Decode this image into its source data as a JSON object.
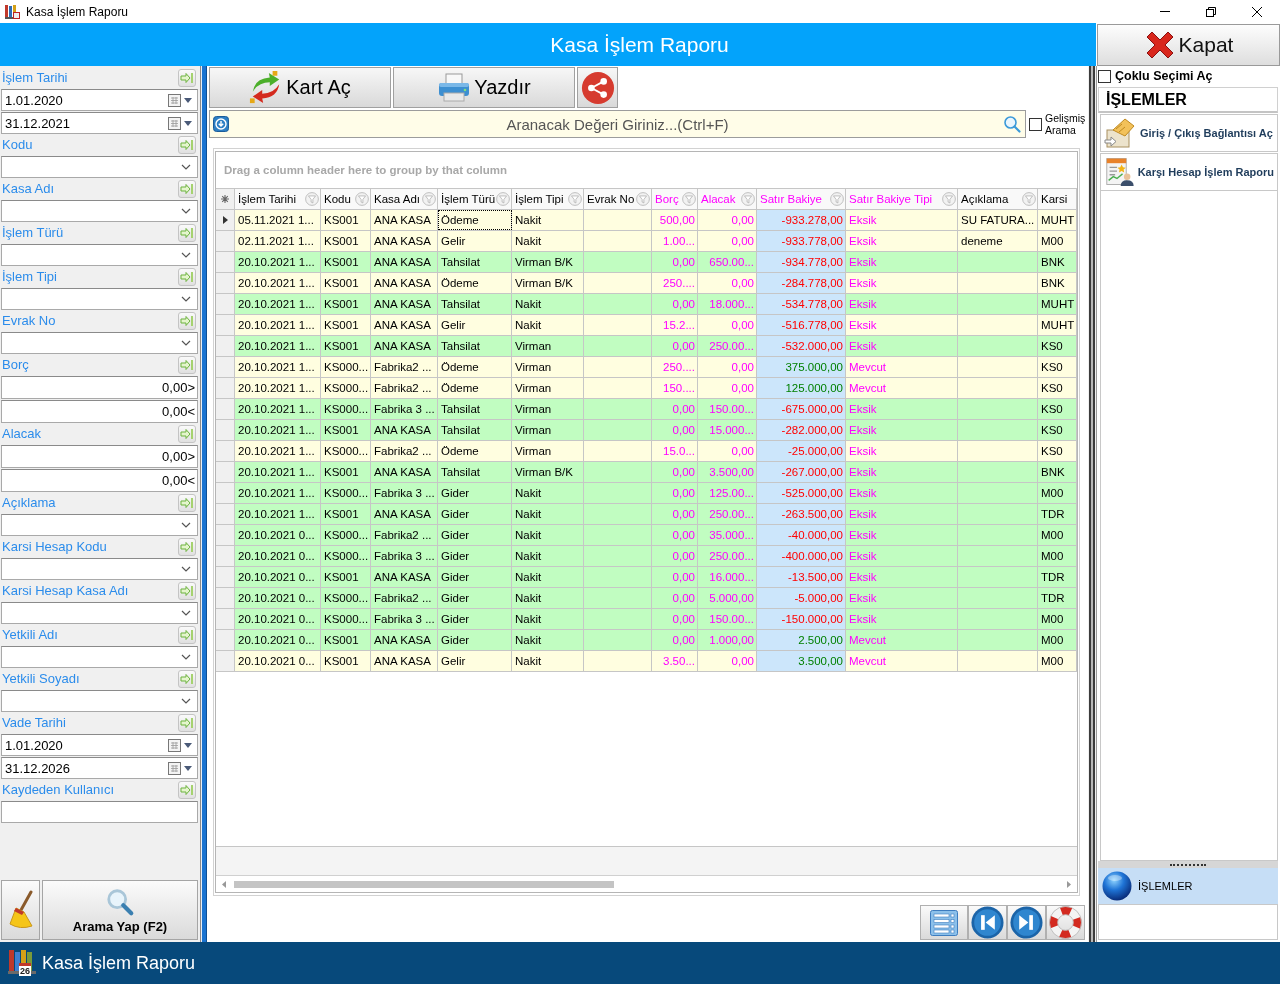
{
  "window": {
    "title": "Kasa İşlem Raporu"
  },
  "header": {
    "title": "Kasa İşlem Raporu",
    "close_button": "Kapat"
  },
  "filters": [
    {
      "kind": "date_range",
      "label": "İşlem Tarihi",
      "values": [
        "1.01.2020",
        "31.12.2021"
      ]
    },
    {
      "kind": "combo",
      "label": "Kodu"
    },
    {
      "kind": "combo",
      "label": "Kasa Adı"
    },
    {
      "kind": "combo",
      "label": "İşlem Türü"
    },
    {
      "kind": "combo",
      "label": "İşlem Tipi"
    },
    {
      "kind": "combo",
      "label": "Evrak No"
    },
    {
      "kind": "number_range",
      "label": "Borç",
      "values": [
        {
          "value": "0,00",
          "operator": ">"
        },
        {
          "value": "0,00",
          "operator": "<"
        }
      ]
    },
    {
      "kind": "number_range",
      "label": "Alacak",
      "values": [
        {
          "value": "0,00",
          "operator": ">"
        },
        {
          "value": "0,00",
          "operator": "<"
        }
      ]
    },
    {
      "kind": "combo",
      "label": "Açıklama"
    },
    {
      "kind": "combo",
      "label": "Karsi Hesap Kodu"
    },
    {
      "kind": "combo",
      "label": "Karsi Hesap Kasa Adı"
    },
    {
      "kind": "combo",
      "label": "Yetkili Adı"
    },
    {
      "kind": "combo",
      "label": "Yetkili Soyadı"
    },
    {
      "kind": "date_range",
      "label": "Vade Tarihi",
      "values": [
        "1.01.2020",
        "31.12.2026"
      ]
    },
    {
      "kind": "text",
      "label": "Kaydeden Kullanıcı"
    }
  ],
  "search_button": "Arama Yap (F2)",
  "toolbar": [
    {
      "kind": "open_card",
      "label": "Kart Aç"
    },
    {
      "kind": "print",
      "label": "Yazdır"
    },
    {
      "kind": "share"
    }
  ],
  "search": {
    "placeholder": "Aranacak Değeri Giriniz...(Ctrl+F)",
    "advanced_label": "Gelişmiş Arama",
    "advanced_checked": false
  },
  "table": {
    "group_hint": "Drag a column header here to group by that column",
    "columns": [
      {
        "label": "İşlem Tarihi",
        "kind": "text",
        "highlighted": false,
        "filter": true,
        "focused": false
      },
      {
        "label": "Kodu",
        "kind": "text",
        "highlighted": false,
        "filter": true,
        "focused": false
      },
      {
        "label": "Kasa Adı",
        "kind": "text",
        "highlighted": false,
        "filter": true,
        "focused": false
      },
      {
        "label": "İşlem Türü",
        "kind": "text",
        "highlighted": false,
        "filter": true,
        "focused": true
      },
      {
        "label": "İşlem Tipi",
        "kind": "text",
        "highlighted": false,
        "filter": true,
        "focused": false
      },
      {
        "label": "Evrak No",
        "kind": "text",
        "highlighted": false,
        "filter": true,
        "focused": false
      },
      {
        "label": "Borç",
        "kind": "number",
        "highlighted": true,
        "filter": true,
        "focused": false
      },
      {
        "label": "Alacak",
        "kind": "number",
        "highlighted": true,
        "filter": true,
        "focused": false
      },
      {
        "label": "Satır Bakiye",
        "kind": "balance",
        "highlighted": true,
        "filter": true,
        "focused": false
      },
      {
        "label": "Satır Bakiye Tipi",
        "kind": "text",
        "highlighted": true,
        "filter": true,
        "focused": false
      },
      {
        "label": "Açıklama",
        "kind": "text",
        "highlighted": false,
        "filter": true,
        "focused": false
      },
      {
        "label": "Karsi",
        "kind": "text",
        "highlighted": false,
        "filter": false,
        "focused": false
      }
    ],
    "rows": [
      {
        "selected": true,
        "color": "#fffee0",
        "date": "05.11.2021 1...",
        "code": "KS001",
        "cash_name": "ANA KASA",
        "type": "Ödeme",
        "method": "Nakit",
        "debit": "500,00",
        "credit": "0,00",
        "balance": {
          "text": "-933.278,00",
          "color": "#ff0000"
        },
        "balance_type": "Eksik",
        "note": "SU FATURA...",
        "counter_account": "MUHT"
      },
      {
        "selected": false,
        "color": "#fffee0",
        "date": "02.11.2021 1...",
        "code": "KS001",
        "cash_name": "ANA KASA",
        "type": "Gelir",
        "method": "Nakit",
        "debit": "1.00...",
        "credit": "0,00",
        "balance": {
          "text": "-933.778,00",
          "color": "#ff0000"
        },
        "balance_type": "Eksik",
        "note": "deneme",
        "counter_account": "M00"
      },
      {
        "selected": false,
        "color": "#c1fdc1",
        "date": "20.10.2021 1...",
        "code": "KS001",
        "cash_name": "ANA KASA",
        "type": "Tahsilat",
        "method": "Virman B/K",
        "debit": "0,00",
        "credit": "650.00...",
        "balance": {
          "text": "-934.778,00",
          "color": "#ff0000"
        },
        "balance_type": "Eksik",
        "counter_account": "BNK"
      },
      {
        "selected": false,
        "color": "#fffee0",
        "date": "20.10.2021 1...",
        "code": "KS001",
        "cash_name": "ANA KASA",
        "type": "Ödeme",
        "method": "Virman B/K",
        "debit": "250....",
        "credit": "0,00",
        "balance": {
          "text": "-284.778,00",
          "color": "#ff0000"
        },
        "balance_type": "Eksik",
        "counter_account": "BNK"
      },
      {
        "selected": false,
        "color": "#c1fdc1",
        "date": "20.10.2021 1...",
        "code": "KS001",
        "cash_name": "ANA KASA",
        "type": "Tahsilat",
        "method": "Nakit",
        "debit": "0,00",
        "credit": "18.000...",
        "balance": {
          "text": "-534.778,00",
          "color": "#ff0000"
        },
        "balance_type": "Eksik",
        "counter_account": "MUHT"
      },
      {
        "selected": false,
        "color": "#fffee0",
        "date": "20.10.2021 1...",
        "code": "KS001",
        "cash_name": "ANA KASA",
        "type": "Gelir",
        "method": "Nakit",
        "debit": "15.2...",
        "credit": "0,00",
        "balance": {
          "text": "-516.778,00",
          "color": "#ff0000"
        },
        "balance_type": "Eksik",
        "counter_account": "MUHT"
      },
      {
        "selected": false,
        "color": "#c1fdc1",
        "date": "20.10.2021 1...",
        "code": "KS001",
        "cash_name": "ANA KASA",
        "type": "Tahsilat",
        "method": "Virman",
        "debit": "0,00",
        "credit": "250.00...",
        "balance": {
          "text": "-532.000,00",
          "color": "#ff0000"
        },
        "balance_type": "Eksik",
        "counter_account": "KS0"
      },
      {
        "selected": false,
        "color": "#fffee0",
        "date": "20.10.2021 1...",
        "code": "KS000...",
        "cash_name": "Fabrika2 ...",
        "type": "Ödeme",
        "method": "Virman",
        "debit": "250....",
        "credit": "0,00",
        "balance": {
          "text": "375.000,00",
          "color": "#008000"
        },
        "balance_type": "Mevcut",
        "counter_account": "KS0"
      },
      {
        "selected": false,
        "color": "#fffee0",
        "date": "20.10.2021 1...",
        "code": "KS000...",
        "cash_name": "Fabrika2 ...",
        "type": "Ödeme",
        "method": "Virman",
        "debit": "150....",
        "credit": "0,00",
        "balance": {
          "text": "125.000,00",
          "color": "#008000"
        },
        "balance_type": "Mevcut",
        "counter_account": "KS0"
      },
      {
        "selected": false,
        "color": "#c1fdc1",
        "date": "20.10.2021 1...",
        "code": "KS000...",
        "cash_name": "Fabrika 3 ...",
        "type": "Tahsilat",
        "method": "Virman",
        "debit": "0,00",
        "credit": "150.00...",
        "balance": {
          "text": "-675.000,00",
          "color": "#ff0000"
        },
        "balance_type": "Eksik",
        "counter_account": "KS0"
      },
      {
        "selected": false,
        "color": "#c1fdc1",
        "date": "20.10.2021 1...",
        "code": "KS001",
        "cash_name": "ANA KASA",
        "type": "Tahsilat",
        "method": "Virman",
        "debit": "0,00",
        "credit": "15.000...",
        "balance": {
          "text": "-282.000,00",
          "color": "#ff0000"
        },
        "balance_type": "Eksik",
        "counter_account": "KS0"
      },
      {
        "selected": false,
        "color": "#fffee0",
        "date": "20.10.2021 1...",
        "code": "KS000...",
        "cash_name": "Fabrika2 ...",
        "type": "Ödeme",
        "method": "Virman",
        "debit": "15.0...",
        "credit": "0,00",
        "balance": {
          "text": "-25.000,00",
          "color": "#ff0000"
        },
        "balance_type": "Eksik",
        "counter_account": "KS0"
      },
      {
        "selected": false,
        "color": "#c1fdc1",
        "date": "20.10.2021 1...",
        "code": "KS001",
        "cash_name": "ANA KASA",
        "type": "Tahsilat",
        "method": "Virman B/K",
        "debit": "0,00",
        "credit": "3.500,00",
        "balance": {
          "text": "-267.000,00",
          "color": "#ff0000"
        },
        "balance_type": "Eksik",
        "counter_account": "BNK"
      },
      {
        "selected": false,
        "color": "#c1fdc1",
        "date": "20.10.2021 1...",
        "code": "KS000...",
        "cash_name": "Fabrika 3 ...",
        "type": "Gider",
        "method": "Nakit",
        "debit": "0,00",
        "credit": "125.00...",
        "balance": {
          "text": "-525.000,00",
          "color": "#ff0000"
        },
        "balance_type": "Eksik",
        "counter_account": "M00"
      },
      {
        "selected": false,
        "color": "#c1fdc1",
        "date": "20.10.2021 1...",
        "code": "KS001",
        "cash_name": "ANA KASA",
        "type": "Gider",
        "method": "Nakit",
        "debit": "0,00",
        "credit": "250.00...",
        "balance": {
          "text": "-263.500,00",
          "color": "#ff0000"
        },
        "balance_type": "Eksik",
        "counter_account": "TDR"
      },
      {
        "selected": false,
        "color": "#c1fdc1",
        "date": "20.10.2021 0...",
        "code": "KS000...",
        "cash_name": "Fabrika2 ...",
        "type": "Gider",
        "method": "Nakit",
        "debit": "0,00",
        "credit": "35.000...",
        "balance": {
          "text": "-40.000,00",
          "color": "#ff0000"
        },
        "balance_type": "Eksik",
        "counter_account": "M00"
      },
      {
        "selected": false,
        "color": "#c1fdc1",
        "date": "20.10.2021 0...",
        "code": "KS000...",
        "cash_name": "Fabrika 3 ...",
        "type": "Gider",
        "method": "Nakit",
        "debit": "0,00",
        "credit": "250.00...",
        "balance": {
          "text": "-400.000,00",
          "color": "#ff0000"
        },
        "balance_type": "Eksik",
        "counter_account": "M00"
      },
      {
        "selected": false,
        "color": "#c1fdc1",
        "date": "20.10.2021 0...",
        "code": "KS001",
        "cash_name": "ANA KASA",
        "type": "Gider",
        "method": "Nakit",
        "debit": "0,00",
        "credit": "16.000...",
        "balance": {
          "text": "-13.500,00",
          "color": "#ff0000"
        },
        "balance_type": "Eksik",
        "counter_account": "TDR"
      },
      {
        "selected": false,
        "color": "#c1fdc1",
        "date": "20.10.2021 0...",
        "code": "KS000...",
        "cash_name": "Fabrika2 ...",
        "type": "Gider",
        "method": "Nakit",
        "debit": "0,00",
        "credit": "5.000,00",
        "balance": {
          "text": "-5.000,00",
          "color": "#ff0000"
        },
        "balance_type": "Eksik",
        "counter_account": "TDR"
      },
      {
        "selected": false,
        "color": "#c1fdc1",
        "date": "20.10.2021 0...",
        "code": "KS000...",
        "cash_name": "Fabrika 3 ...",
        "type": "Gider",
        "method": "Nakit",
        "debit": "0,00",
        "credit": "150.00...",
        "balance": {
          "text": "-150.000,00",
          "color": "#ff0000"
        },
        "balance_type": "Eksik",
        "counter_account": "M00"
      },
      {
        "selected": false,
        "color": "#c1fdc1",
        "date": "20.10.2021 0...",
        "code": "KS001",
        "cash_name": "ANA KASA",
        "type": "Gider",
        "method": "Nakit",
        "debit": "0,00",
        "credit": "1.000,00",
        "balance": {
          "text": "2.500,00",
          "color": "#008000"
        },
        "balance_type": "Mevcut",
        "counter_account": "M00"
      },
      {
        "selected": false,
        "color": "#fffee0",
        "date": "20.10.2021 0...",
        "code": "KS001",
        "cash_name": "ANA KASA",
        "type": "Gelir",
        "method": "Nakit",
        "debit": "3.50...",
        "credit": "0,00",
        "balance": {
          "text": "3.500,00",
          "color": "#008000"
        },
        "balance_type": "Mevcut",
        "counter_account": "M00"
      }
    ]
  },
  "right_panel": {
    "multi_select_label": "Çoklu Seçimi Aç",
    "multi_select_checked": false,
    "section_title": "İŞLEMLER",
    "items": [
      {
        "kind": "connection",
        "label": "Giriş / Çıkış Bağlantısı Aç"
      },
      {
        "kind": "report",
        "label": "Karşı Hesap İşlem Raporu"
      }
    ],
    "nav_groups": [
      {
        "label": "İŞLEMLER",
        "selected": true
      }
    ]
  },
  "taskbar": {
    "title": "Kasa İşlem Raporu",
    "calendar_day": "26"
  }
}
